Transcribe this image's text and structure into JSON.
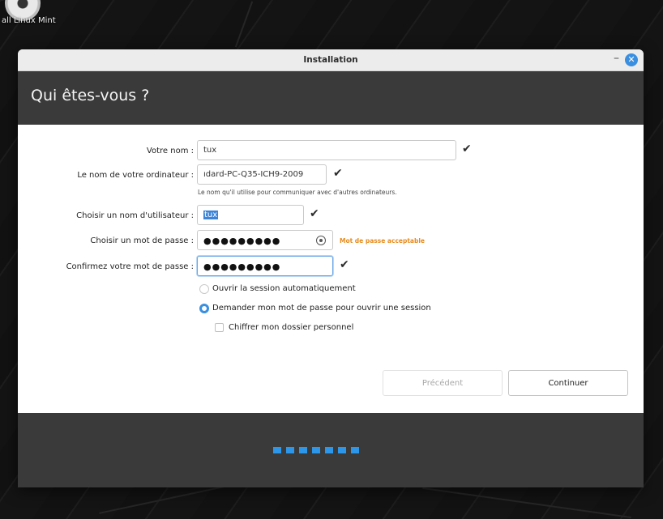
{
  "desktop": {
    "icon_label": "all Linux Mint"
  },
  "window": {
    "title": "Installation",
    "minimize_glyph": "–",
    "close_glyph": "✕"
  },
  "page": {
    "heading": "Qui êtes-vous ?"
  },
  "form": {
    "name": {
      "label": "Votre nom :",
      "value": "tux"
    },
    "computer": {
      "label": "Le nom de votre ordinateur :",
      "value": "ıdard-PC-Q35-ICH9-2009",
      "hint": "Le nom qu'il utilise pour communiquer avec d'autres ordinateurs."
    },
    "username": {
      "label": "Choisir un nom d'utilisateur :",
      "value": "tux"
    },
    "password": {
      "label": "Choisir un mot de passe :",
      "value": "●●●●●●●●●",
      "strength": "Mot de passe acceptable"
    },
    "confirm": {
      "label": "Confirmez votre mot de passe :",
      "value": "●●●●●●●●●"
    },
    "check_glyph": "✔",
    "login_options": [
      {
        "label": "Ouvrir la session automatiquement",
        "selected": false
      },
      {
        "label": "Demander mon mot de passe pour ouvrir une session",
        "selected": true
      }
    ],
    "encrypt_home": {
      "label": "Chiffrer mon dossier personnel",
      "checked": false
    }
  },
  "buttons": {
    "back": "Précédent",
    "continue": "Continuer"
  },
  "progress": {
    "steps": 7
  }
}
